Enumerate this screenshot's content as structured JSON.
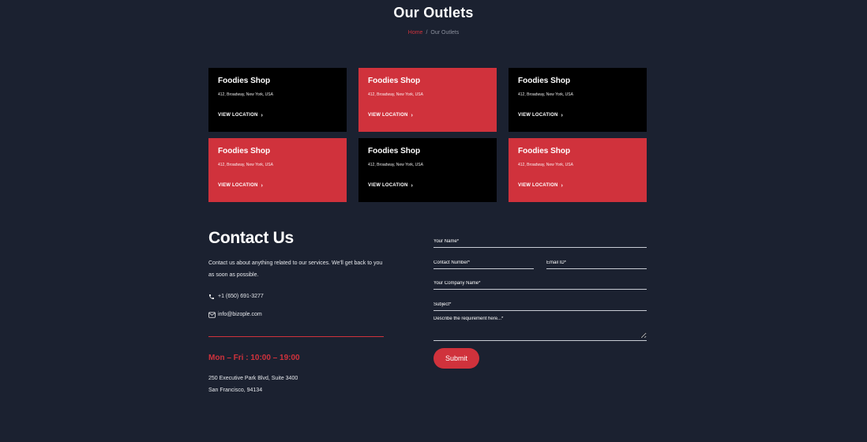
{
  "header": {
    "title": "Our Outlets",
    "breadcrumb": {
      "home": "Home",
      "separator": "/",
      "current": "Our Outlets"
    }
  },
  "outlets": [
    {
      "name": "Foodies Shop",
      "address": "412, Broadway, New York, USA",
      "link": "VIEW LOCATION",
      "style": "dark"
    },
    {
      "name": "Foodies Shop",
      "address": "412, Broadway, New York, USA",
      "link": "VIEW LOCATION",
      "style": "red"
    },
    {
      "name": "Foodies Shop",
      "address": "412, Broadway, New York, USA",
      "link": "VIEW LOCATION",
      "style": "dark"
    },
    {
      "name": "Foodies Shop",
      "address": "412, Broadway, New York, USA",
      "link": "VIEW LOCATION",
      "style": "red"
    },
    {
      "name": "Foodies Shop",
      "address": "412, Broadway, New York, USA",
      "link": "VIEW LOCATION",
      "style": "dark"
    },
    {
      "name": "Foodies Shop",
      "address": "412, Broadway, New York, USA",
      "link": "VIEW LOCATION",
      "style": "red"
    }
  ],
  "contact": {
    "title": "Contact Us",
    "description": "Contact us about anything related to our services. We'll get back to you as soon as possible.",
    "phone": "+1 (650) 691-3277",
    "email": "info@bizople.com",
    "hours": "Mon – Fri : 10:00 – 19:00",
    "address_line1": "250 Executive Park Blvd, Suite 3400",
    "address_line2": "San Francisco, 94134"
  },
  "form": {
    "name_placeholder": "Your Name*",
    "contact_placeholder": "Contact Number*",
    "email_placeholder": "Email ID*",
    "company_placeholder": "Your Company Name*",
    "subject_placeholder": "Subject*",
    "description_placeholder": "Describe the requirement here...*",
    "submit_label": "Submit"
  },
  "colors": {
    "background": "#1b2130",
    "accent": "#d0323c",
    "card_dark": "#000000"
  },
  "icons": {
    "phone": "phone-icon",
    "email": "envelope-icon",
    "link_arrow": "chevron-right-icon"
  }
}
